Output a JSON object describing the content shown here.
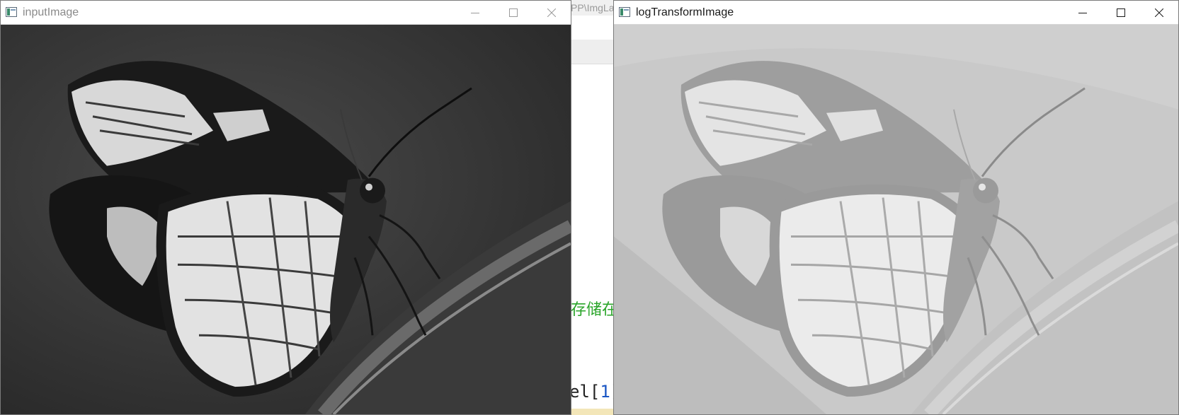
{
  "windows": [
    {
      "title": "inputImage",
      "active": false,
      "controls": [
        "minimize-icon",
        "maximize-icon",
        "close-icon"
      ],
      "content": "grayscale butterfly photograph (original)"
    },
    {
      "title": "logTransformImage",
      "active": true,
      "controls": [
        "minimize-icon",
        "maximize-icon",
        "close-icon"
      ],
      "content": "log-transformed grayscale butterfly photograph"
    }
  ],
  "background_ide": {
    "top_text": "PP\\ImgLa",
    "chinese_text": "存储在",
    "code_text_prefix": "el[",
    "code_text_number": "1",
    "code_text_suffix": "]"
  },
  "colors": {
    "left_image_background": "#2f2f2f",
    "right_image_background": "#c4c4c4",
    "comment_green": "#2aa52a",
    "number_blue": "#1a56c4"
  }
}
